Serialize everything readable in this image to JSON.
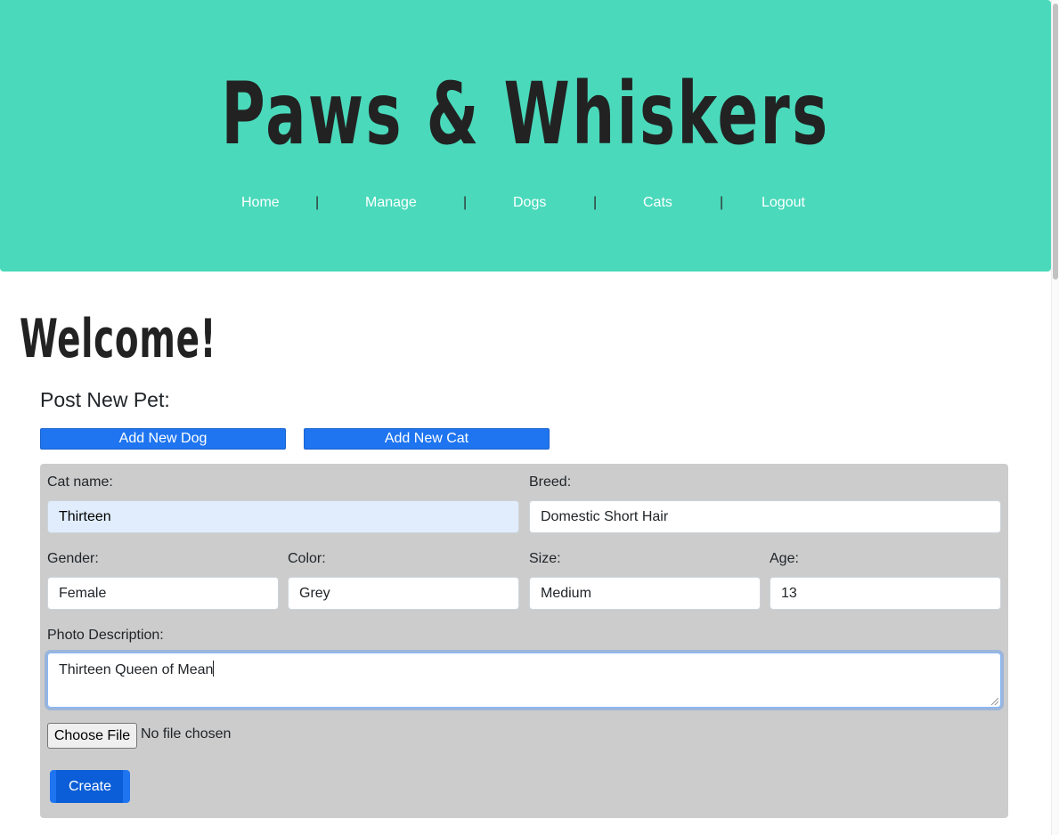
{
  "header": {
    "site_title": "Paws & Whiskers",
    "nav": [
      {
        "label": "Home"
      },
      {
        "label": "Manage"
      },
      {
        "label": "Dogs"
      },
      {
        "label": "Cats"
      },
      {
        "label": "Logout"
      }
    ],
    "separator": "|",
    "background_color": "#4ad9bb"
  },
  "main": {
    "welcome": "Welcome!",
    "post_label": "Post New Pet:",
    "add_dog_label": "Add New Dog",
    "add_cat_label": "Add New Cat"
  },
  "form": {
    "cat_name": {
      "label": "Cat name:",
      "value": "Thirteen"
    },
    "breed": {
      "label": "Breed:",
      "value": "Domestic Short Hair"
    },
    "gender": {
      "label": "Gender:",
      "value": "Female"
    },
    "color": {
      "label": "Color:",
      "value": "Grey"
    },
    "size": {
      "label": "Size:",
      "value": "Medium"
    },
    "age": {
      "label": "Age:",
      "value": "13"
    },
    "photo_description": {
      "label": "Photo Description:",
      "value": "Thirteen Queen of Mean"
    },
    "file": {
      "button_label": "Choose File",
      "status": "No file chosen"
    },
    "create_label": "Create"
  },
  "colors": {
    "primary": "#1f75f0",
    "panel": "#cccccc"
  }
}
